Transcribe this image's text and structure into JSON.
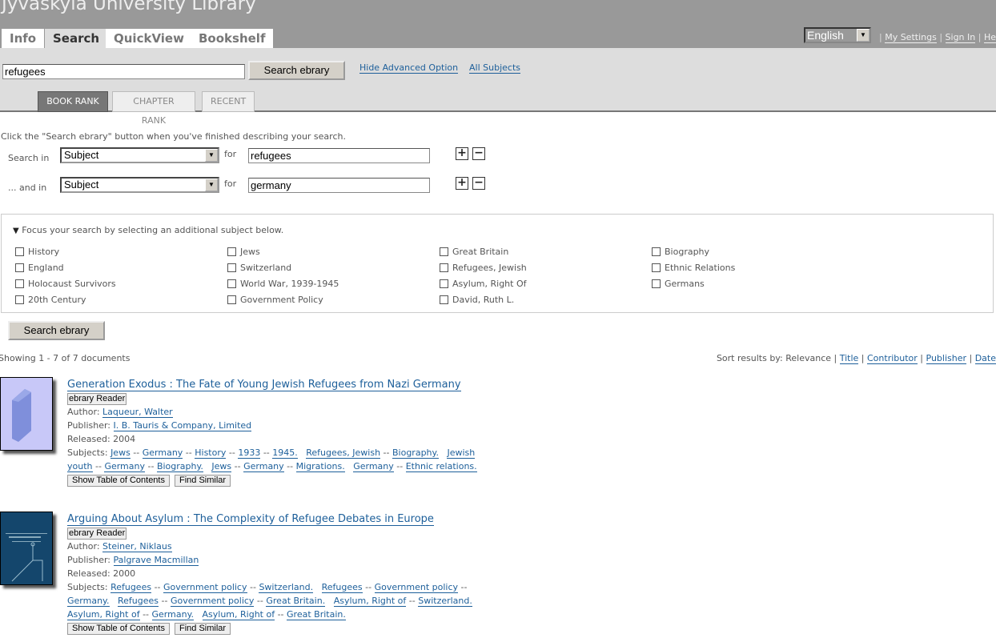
{
  "header": {
    "title": "Jyvaskyla University Library",
    "tabs": [
      "Info",
      "Search",
      "QuickView",
      "Bookshelf"
    ],
    "language": "English",
    "links": [
      "My Settings",
      "Sign In",
      "Help"
    ]
  },
  "search": {
    "query": "refugees",
    "button": "Search ebrary",
    "hide_advanced": "Hide Advanced Option",
    "all_subjects": "All Subjects",
    "rank_tabs": [
      "BOOK RANK",
      "CHAPTER RANK",
      "RECENT"
    ]
  },
  "advanced": {
    "instruction": "Click the \"Search ebrary\" button when you've finished describing your search.",
    "rows": [
      {
        "label": "Search in",
        "field": "Subject",
        "for": "for",
        "value": "refugees"
      },
      {
        "label": "... and in",
        "field": "Subject",
        "for": "for",
        "value": "germany"
      }
    ],
    "add": "+",
    "remove": "−"
  },
  "focus": {
    "heading": "Focus your search by selecting an additional subject below.",
    "columns": [
      [
        "History",
        "England",
        "Holocaust Survivors",
        "20th Century"
      ],
      [
        "Jews",
        "Switzerland",
        "World War, 1939-1945",
        "Government Policy"
      ],
      [
        "Great Britain",
        "Refugees, Jewish",
        "Asylum, Right Of",
        "David, Ruth L."
      ],
      [
        "Biography",
        "Ethnic Relations",
        "Germans"
      ]
    ],
    "button": "Search ebrary"
  },
  "results": {
    "showing": "Showing 1 - 7 of 7 documents",
    "sort_label": "Sort results by:",
    "sort_current": "Relevance",
    "sort_links": [
      "Title",
      "Contributor",
      "Publisher",
      "Date"
    ],
    "items": [
      {
        "title": "Generation Exodus : The Fate of Young Jewish Refugees from Nazi Germany",
        "reader": "ebrary Reader",
        "author_label": "Author:",
        "author": "Laqueur, Walter",
        "publisher_label": "Publisher:",
        "publisher": "I. B. Tauris & Company, Limited",
        "released_label": "Released:",
        "released": "2004",
        "subjects_label": "Subjects:",
        "subjects": [
          [
            "Jews",
            "Germany",
            "History",
            "1933",
            "1945."
          ],
          [
            "Refugees, Jewish",
            "Biography."
          ],
          [
            "Jewish youth",
            "Germany",
            "Biography."
          ],
          [
            "Jews",
            "Germany",
            "Migrations."
          ],
          [
            "Germany",
            "Ethnic relations."
          ]
        ],
        "toc": "Show Table of Contents",
        "similar": "Find Similar",
        "cover": "generic-book-icon"
      },
      {
        "title": "Arguing About Asylum : The Complexity of Refugee Debates in Europe",
        "reader": "ebrary Reader",
        "author_label": "Author:",
        "author": "Steiner, Niklaus",
        "publisher_label": "Publisher:",
        "publisher": "Palgrave Macmillan",
        "released_label": "Released:",
        "released": "2000",
        "subjects_label": "Subjects:",
        "subjects": [
          [
            "Refugees",
            "Government policy",
            "Switzerland."
          ],
          [
            "Refugees",
            "Government policy",
            "Germany."
          ],
          [
            "Refugees",
            "Government policy",
            "Great Britain."
          ],
          [
            "Asylum, Right of",
            "Switzerland."
          ],
          [
            "Asylum, Right of",
            "Germany."
          ],
          [
            "Asylum, Right of",
            "Great Britain."
          ]
        ],
        "toc": "Show Table of Contents",
        "similar": "Find Similar",
        "cover": "book-cover-image"
      }
    ]
  }
}
